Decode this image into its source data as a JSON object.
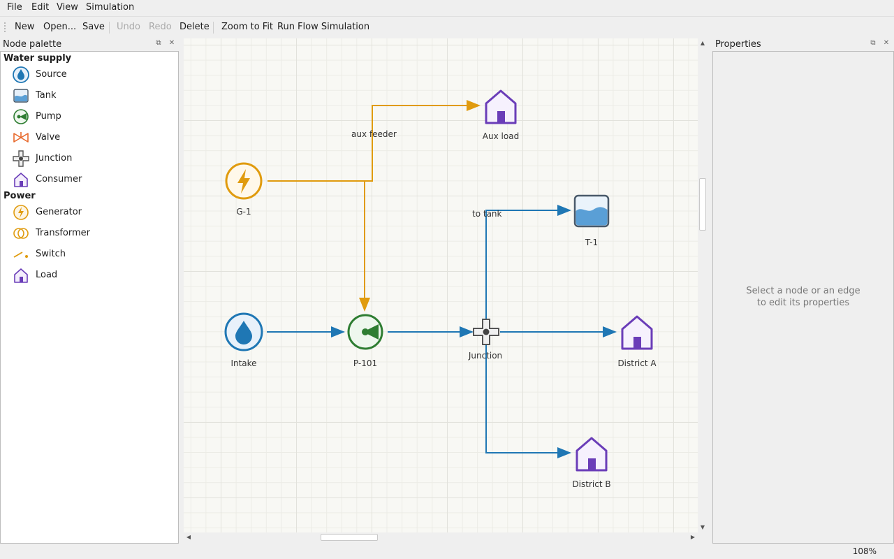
{
  "menu": {
    "file": "File",
    "edit": "Edit",
    "view": "View",
    "simulation": "Simulation"
  },
  "toolbar": {
    "new": "New",
    "open": "Open...",
    "save": "Save",
    "undo": "Undo",
    "redo": "Redo",
    "delete": "Delete",
    "zoom_to_fit": "Zoom to Fit",
    "run_sim": "Run Flow Simulation"
  },
  "palette": {
    "title": "Node palette",
    "groups": [
      {
        "name": "Water supply",
        "items": [
          {
            "label": "Source",
            "icon": "water-drop-icon"
          },
          {
            "label": "Tank",
            "icon": "tank-icon"
          },
          {
            "label": "Pump",
            "icon": "pump-icon"
          },
          {
            "label": "Valve",
            "icon": "valve-icon"
          },
          {
            "label": "Junction",
            "icon": "junction-icon"
          },
          {
            "label": "Consumer",
            "icon": "house-icon"
          }
        ]
      },
      {
        "name": "Power",
        "items": [
          {
            "label": "Generator",
            "icon": "lightning-icon"
          },
          {
            "label": "Transformer",
            "icon": "transformer-icon"
          },
          {
            "label": "Switch",
            "icon": "switch-icon"
          },
          {
            "label": "Load",
            "icon": "house-icon"
          }
        ]
      }
    ]
  },
  "canvas": {
    "nodes": {
      "g1": "G-1",
      "aux_load": "Aux load",
      "t1": "T-1",
      "intake": "Intake",
      "p101": "P-101",
      "junction": "Junction",
      "district_a": "District A",
      "district_b": "District B"
    },
    "edge_labels": {
      "aux_feeder": "aux feeder",
      "to_tank": "to tank"
    }
  },
  "properties": {
    "title": "Properties",
    "hint_line1": "Select a node or an edge",
    "hint_line2": "to edit its properties"
  },
  "status": {
    "zoom": "108%"
  },
  "colors": {
    "water": "#1f77b4",
    "power": "#e09b0e",
    "pump": "#2e7d32",
    "consumer": "#6a3db8",
    "valve": "#e8692c"
  }
}
